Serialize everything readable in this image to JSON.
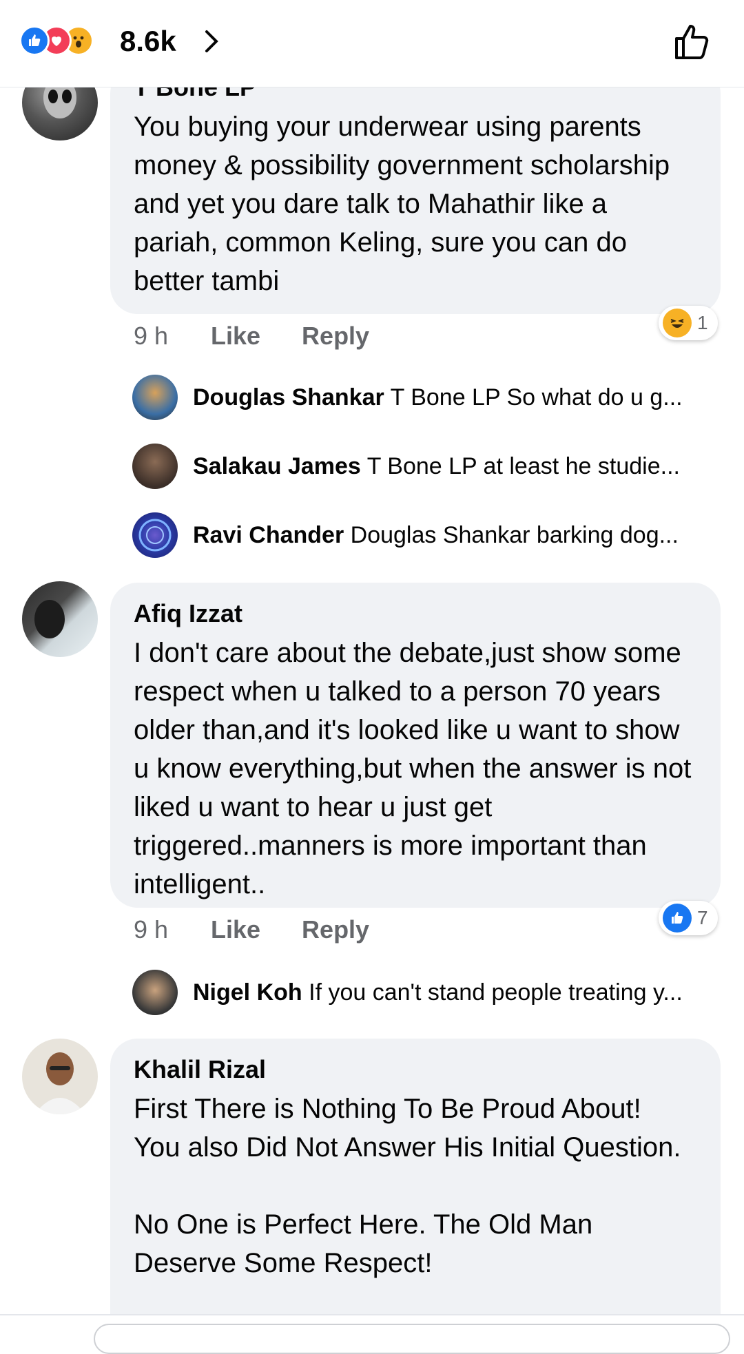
{
  "header": {
    "reaction_count": "8.6k",
    "reaction_icons": [
      "like-icon",
      "love-icon",
      "wow-icon"
    ],
    "action_icon": "thumbs-up-outline-icon"
  },
  "colors": {
    "like_blue": "#1877f2",
    "love_red": "#f33e58",
    "wow_yellow": "#f7b125",
    "bubble": "#f0f2f5",
    "meta_gray": "#65676b"
  },
  "comments": [
    {
      "author": "T Bone LP",
      "text": "You buying your underwear using parents money & possibility government scholarship and yet you dare talk to Mahathir like a pariah, common Keling, sure you can do better tambi",
      "time": "9 h",
      "like": "Like",
      "reply": "Reply",
      "reaction": {
        "icon": "laughing-emoji-icon",
        "count": "1"
      },
      "replies": [
        {
          "name": "Douglas Shankar",
          "text": "T Bone LP So what do u g..."
        },
        {
          "name": "Salakau James",
          "text": "T Bone LP at least he studie..."
        },
        {
          "name": "Ravi Chander",
          "text": "Douglas Shankar barking dog..."
        }
      ]
    },
    {
      "author": "Afiq Izzat",
      "text": "I don't care about the debate,just show some respect when u talked to a person 70 years older than,and it's looked like u want to show u know everything,but when the answer is not liked u want to hear u just get triggered..manners is more important than intelligent..",
      "time": "9 h",
      "like": "Like",
      "reply": "Reply",
      "reaction": {
        "icon": "like-icon",
        "count": "7"
      },
      "replies": [
        {
          "name": "Nigel Koh",
          "text": "If you can't stand people treating y..."
        }
      ]
    },
    {
      "author": "Khalil Rizal",
      "text": "First There is Nothing To Be Proud About!\nYou also Did Not Answer His Initial Question.\n\nNo One is Perfect Here. The Old Man Deserve Some Respect!"
    }
  ]
}
